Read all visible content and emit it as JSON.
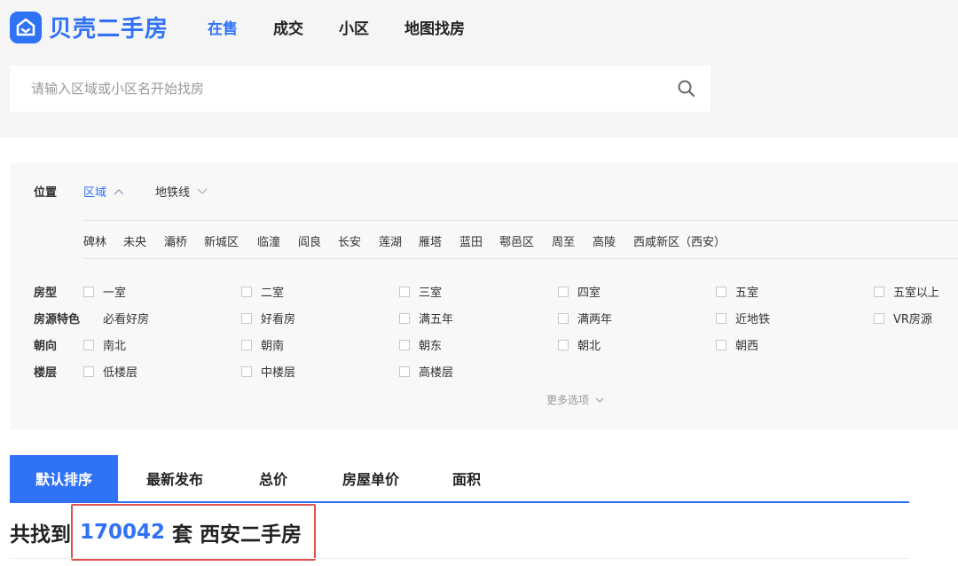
{
  "header": {
    "logo_text": "贝壳二手房",
    "nav": [
      "在售",
      "成交",
      "小区",
      "地图找房"
    ]
  },
  "search": {
    "placeholder": "请输入区域或小区名开始找房"
  },
  "filter": {
    "position_label": "位置",
    "position_tabs": [
      "区域",
      "地铁线"
    ],
    "districts": [
      "碑林",
      "未央",
      "灞桥",
      "新城区",
      "临潼",
      "阎良",
      "长安",
      "莲湖",
      "雁塔",
      "蓝田",
      "鄠邑区",
      "周至",
      "高陵",
      "西咸新区（西安）"
    ],
    "rows": [
      {
        "label": "房型",
        "options": [
          "一室",
          "二室",
          "三室",
          "四室",
          "五室",
          "五室以上"
        ]
      },
      {
        "label": "房源特色",
        "options": [
          "必看好房",
          "好看房",
          "满五年",
          "满两年",
          "近地铁",
          "VR房源"
        ]
      },
      {
        "label": "朝向",
        "options": [
          "南北",
          "朝南",
          "朝东",
          "朝北",
          "朝西"
        ]
      },
      {
        "label": "楼层",
        "options": [
          "低楼层",
          "中楼层",
          "高楼层"
        ]
      }
    ],
    "more_options": "更多选项"
  },
  "sort": {
    "tabs": [
      "默认排序",
      "最新发布",
      "总价",
      "房屋单价",
      "面积"
    ]
  },
  "result": {
    "prefix": "共找到",
    "count": "170042",
    "unit": "套",
    "city_label": "西安二手房"
  },
  "colors": {
    "accent": "#3072f6",
    "highlight": "#e0514d"
  }
}
